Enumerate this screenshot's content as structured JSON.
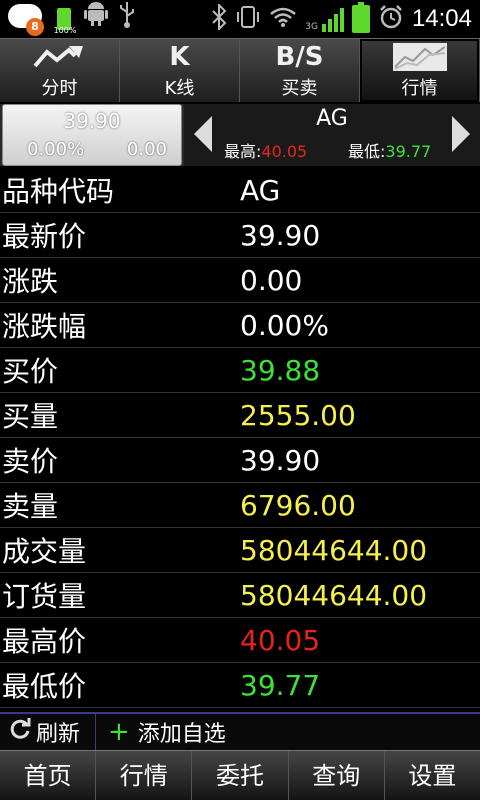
{
  "status_bar": {
    "notification_count": "8",
    "battery_small_label": "100%",
    "network_label": "3G",
    "time": "14:04",
    "icons": [
      "app-notification-icon",
      "battery-icon",
      "android-icon",
      "usb-icon",
      "bluetooth-icon",
      "vibrate-icon",
      "wifi-icon",
      "signal-icon",
      "battery-icon",
      "alarm-icon"
    ],
    "accent_green": "#5fd82d"
  },
  "top_nav": {
    "tabs": [
      {
        "label": "分时",
        "icon": "line-chart-icon",
        "glyph": "⤴"
      },
      {
        "label": "K线",
        "icon": "k-icon",
        "glyph": "K"
      },
      {
        "label": "买卖",
        "icon": "bs-icon",
        "glyph": "B/S"
      },
      {
        "label": "行情",
        "icon": "quote-chart-icon",
        "glyph": ""
      }
    ],
    "active_index": 3
  },
  "quote": {
    "price": "39.90",
    "change_pct": "0.00%",
    "change": "0.00",
    "code": "AG",
    "high_label": "最高:",
    "high_value": "40.05",
    "low_label": "最低:",
    "low_value": "39.77"
  },
  "rows": [
    {
      "label": "品种代码",
      "value": "AG",
      "color": "white"
    },
    {
      "label": "最新价",
      "value": "39.90",
      "color": "white"
    },
    {
      "label": "涨跌",
      "value": "0.00",
      "color": "white"
    },
    {
      "label": "涨跌幅",
      "value": "0.00%",
      "color": "white"
    },
    {
      "label": "买价",
      "value": "39.88",
      "color": "green"
    },
    {
      "label": "买量",
      "value": "2555.00",
      "color": "yellow"
    },
    {
      "label": "卖价",
      "value": "39.90",
      "color": "white"
    },
    {
      "label": "卖量",
      "value": "6796.00",
      "color": "yellow"
    },
    {
      "label": "成交量",
      "value": "58044644.00",
      "color": "yellow"
    },
    {
      "label": "订货量",
      "value": "58044644.00",
      "color": "yellow"
    },
    {
      "label": "最高价",
      "value": "40.05",
      "color": "red"
    },
    {
      "label": "最低价",
      "value": "39.77",
      "color": "green"
    }
  ],
  "action_bar": {
    "refresh_label": "刷新",
    "add_label": "添加自选"
  },
  "bottom_nav": {
    "items": [
      "首页",
      "行情",
      "委托",
      "查询",
      "设置"
    ]
  },
  "colors": {
    "red": "#e52420",
    "green": "#3ce13c",
    "yellow": "#f6f04a"
  }
}
